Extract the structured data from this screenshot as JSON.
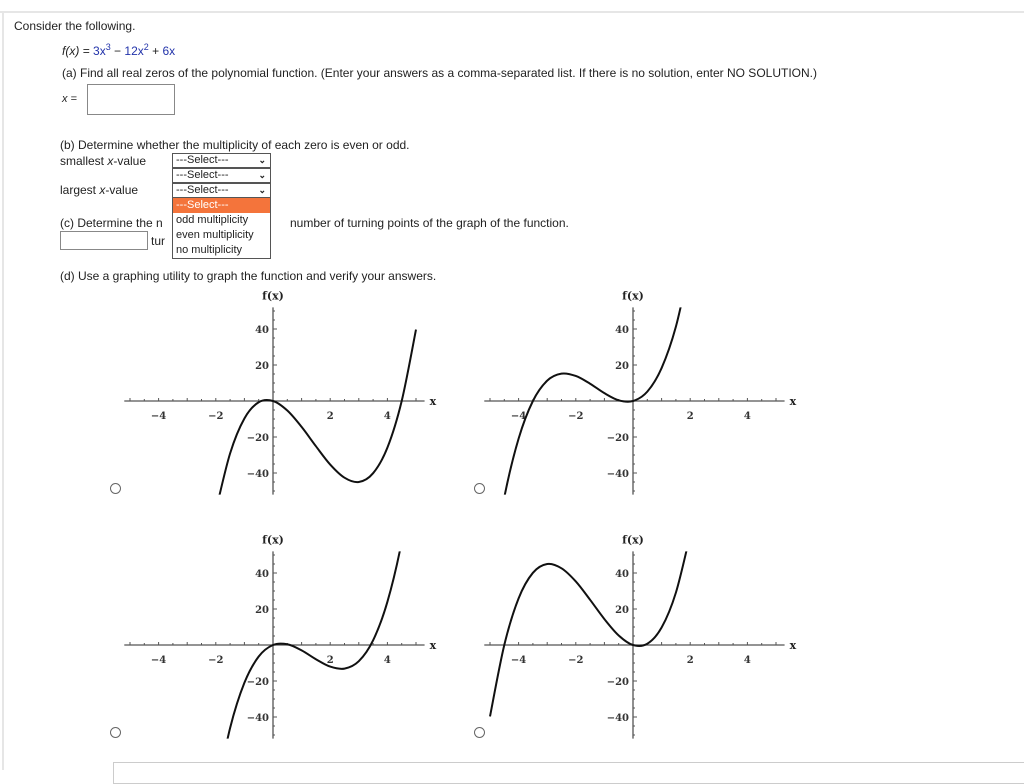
{
  "intro": "Consider the following.",
  "function": {
    "lhs": "f(x) = ",
    "t1": "3x",
    "e1": "3",
    "op1": " − ",
    "t2": "12x",
    "e2": "2",
    "op2": " + ",
    "t3": "6x"
  },
  "part_a": {
    "prompt": "(a) Find all real zeros of the polynomial function. (Enter your answers as a comma-separated list. If there is no solution, enter NO SOLUTION.)",
    "label": "x =",
    "value": ""
  },
  "part_b": {
    "prompt": "(b) Determine whether the multiplicity of each zero is even or odd.",
    "rows": [
      {
        "label_pre": "smallest ",
        "label_var": "x",
        "label_post": "-value",
        "selected": "---Select---"
      },
      {
        "label_pre": "",
        "label_var": "",
        "label_post": "",
        "selected": "---Select---"
      },
      {
        "label_pre": "largest ",
        "label_var": "x",
        "label_post": "-value",
        "selected": "---Select---"
      }
    ],
    "dropdown_options": [
      "---Select---",
      "odd multiplicity",
      "even multiplicity",
      "no multiplicity"
    ],
    "highlight_color": "#f4743b"
  },
  "part_c": {
    "prompt_start": "(c) Determine the n",
    "prompt_end": "number of turning points of the graph of the function.",
    "input_suffix": "tur",
    "value": ""
  },
  "part_d": {
    "prompt": "(d) Use a graphing utility to graph the function and verify your answers."
  },
  "chart_data": [
    {
      "type": "line",
      "ylabel": "f(x)",
      "xlabel": "x",
      "xlim": [
        -5.2,
        5.3
      ],
      "ylim": [
        -52,
        52
      ],
      "xticks": [
        -4,
        -2,
        2,
        4
      ],
      "yticks": [
        40,
        20,
        -20,
        -40
      ],
      "x": [
        -2,
        -1.5,
        -1,
        -0.5,
        0,
        0.5,
        1,
        1.5,
        2,
        2.5,
        3,
        3.5,
        4,
        4.5,
        5
      ],
      "y": [
        -61,
        -29.1,
        -9.7,
        -0.7,
        0,
        -5.3,
        -14.4,
        -25.1,
        -35.3,
        -42.6,
        -45,
        -40.1,
        -25.9,
        0,
        39.7
      ],
      "selected": false
    },
    {
      "type": "line",
      "ylabel": "f(x)",
      "xlabel": "x",
      "xlim": [
        -5.2,
        5.3
      ],
      "ylim": [
        -52,
        52
      ],
      "xticks": [
        -4,
        -2,
        2,
        4
      ],
      "yticks": [
        40,
        20,
        -20,
        -40
      ],
      "x": [
        -5,
        -4.5,
        -4,
        -3.5,
        -3,
        -2.5,
        -2,
        -1.5,
        -1,
        -0.5,
        0,
        0.5,
        1,
        1.5,
        2
      ],
      "y": [
        -100,
        -53.5,
        -20.9,
        0,
        11.3,
        15.2,
        13.9,
        9.6,
        4.35,
        0.4,
        0,
        5.2,
        18.3,
        41.3,
        76.6
      ],
      "selected": false
    },
    {
      "type": "line",
      "ylabel": "f(x)",
      "xlabel": "x",
      "xlim": [
        -5.2,
        5.3
      ],
      "ylim": [
        -52,
        52
      ],
      "xticks": [
        -4,
        -2,
        2,
        4
      ],
      "yticks": [
        40,
        20,
        -20,
        -40
      ],
      "x": [
        -2,
        -1.5,
        -1,
        -0.5,
        0,
        0.5,
        1,
        1.5,
        2,
        2.5,
        3,
        3.5,
        4,
        4.5,
        5
      ],
      "y": [
        -84,
        -46.1,
        -21,
        -6.4,
        0,
        0.4,
        -3,
        -7.9,
        -12,
        -13.1,
        -9,
        2.6,
        24,
        57.4,
        105
      ],
      "selected": false
    },
    {
      "type": "line",
      "ylabel": "f(x)",
      "xlabel": "x",
      "xlim": [
        -5.2,
        5.3
      ],
      "ylim": [
        -52,
        52
      ],
      "xticks": [
        -4,
        -2,
        2,
        4
      ],
      "yticks": [
        40,
        20,
        -20,
        -40
      ],
      "x": [
        -5,
        -4.5,
        -4,
        -3.5,
        -3,
        -2.5,
        -2,
        -1.5,
        -1,
        -0.5,
        0,
        0.5,
        1,
        1.5,
        2
      ],
      "y": [
        -39.7,
        0,
        25.9,
        40.1,
        45,
        42.6,
        35.3,
        25.1,
        14.4,
        5.3,
        0,
        0.7,
        9.7,
        29.1,
        61.2
      ],
      "selected": false
    }
  ]
}
